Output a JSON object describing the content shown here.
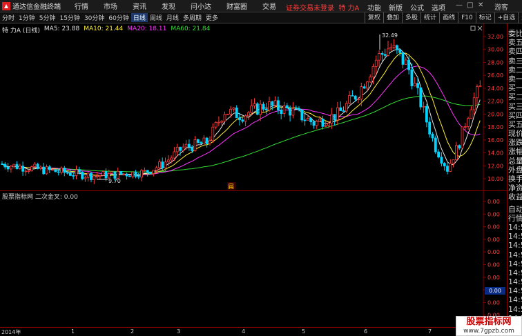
{
  "window": {
    "app_title": "通达信金融终端",
    "menu": [
      "行情",
      "市场",
      "资讯",
      "发现",
      "问小达",
      "财富圈",
      "交易"
    ],
    "warning": "证券交易未登录",
    "stock_title": "特 力A",
    "right_menu": [
      "功能",
      "新版",
      "公式",
      "选项",
      "游客"
    ]
  },
  "toolbar": {
    "periods": [
      "分时",
      "1分钟",
      "5分钟",
      "15分钟",
      "30分钟",
      "60分钟",
      "日线",
      "周线",
      "月线",
      "多周期",
      "更多"
    ],
    "active_period": "日线",
    "tools": [
      "复权",
      "叠加",
      "多股",
      "统计",
      "画线",
      "F10",
      "标记",
      "+自选",
      "返回"
    ]
  },
  "chart_legend": {
    "stock": "特 力A (日线)",
    "ma5": "MA5: 23.88",
    "ma10": "MA10: 21.44",
    "ma20": "MA20: 18.11",
    "ma60": "MA60: 21.84"
  },
  "colors": {
    "up": "#ff3c3c",
    "down": "#00d4ff",
    "ma5": "#e6e6e6",
    "ma10": "#ffee33",
    "ma20": "#ff33ff",
    "ma60": "#33dd33"
  },
  "price_axis": {
    "labels": [
      "32.00",
      "30.00",
      "28.00",
      "26.00",
      "24.00",
      "22.00",
      "20.00",
      "18.00",
      "16.00",
      "14.00",
      "12.00",
      "10.00"
    ]
  },
  "price_annotations": {
    "high": "32.49",
    "low": "9.70",
    "marker": "扁"
  },
  "indicator": {
    "title": "股票指标网  二次金叉: 0.00",
    "axis_labels": [
      "0.00",
      "0.00",
      "0.00",
      "0.00",
      "0.00",
      "0.00",
      "0.00",
      "0.00",
      "0.00",
      "0.00",
      "0.00"
    ],
    "current_value": "0.00"
  },
  "side_panel": {
    "items": [
      "委比",
      "卖五",
      "卖四",
      "卖三",
      "卖二",
      "卖一",
      "买一",
      "买二",
      "买三",
      "买四",
      "买五",
      "现价",
      "涨跌",
      "涨幅",
      "总量",
      "外盘",
      "换手",
      "净资",
      "收益"
    ],
    "items2": [
      "自动",
      "行情",
      "14:5",
      "14:5",
      "14:5",
      "14:5",
      "14:5",
      "14:5",
      "14:5",
      "14:5",
      "14:5",
      "14:5",
      "14:5"
    ]
  },
  "date_axis": {
    "labels": [
      "2014年",
      "1",
      "2",
      "3",
      "4",
      "5",
      "6",
      "7"
    ]
  },
  "watermark": {
    "title": "股票指标网",
    "url": "www.7gpzb.com"
  }
}
